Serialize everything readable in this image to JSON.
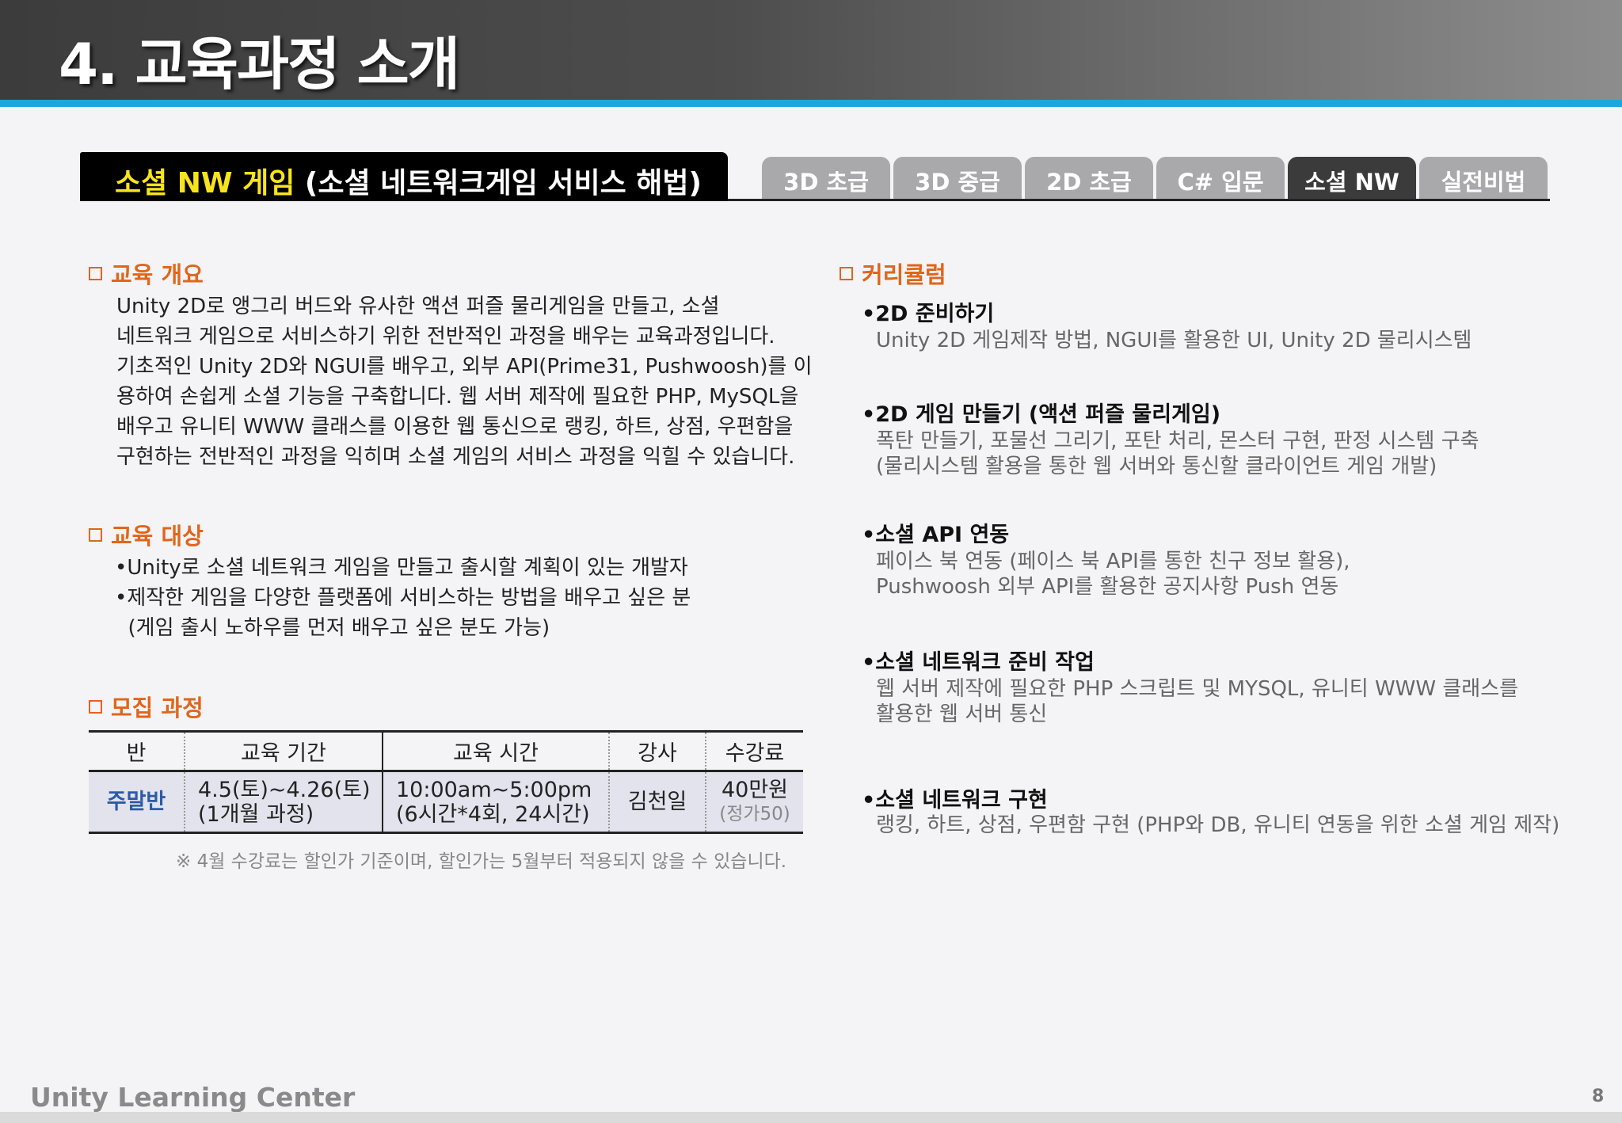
{
  "slide": {
    "title": "4. 교육과정 소개",
    "page_number": "8",
    "footer": "Unity Learning Center"
  },
  "banner": {
    "highlight": "소셜 NW 게임",
    "rest": " (소셜 네트워크게임 서비스 해법)"
  },
  "tabs": [
    {
      "label": "3D 초급",
      "active": false
    },
    {
      "label": "3D 중급",
      "active": false
    },
    {
      "label": "2D 초급",
      "active": false
    },
    {
      "label": "C# 입문",
      "active": false
    },
    {
      "label": "소셜 NW",
      "active": true
    },
    {
      "label": "실전비법",
      "active": false
    }
  ],
  "overview": {
    "heading": "교육 개요",
    "lines": [
      "Unity 2D로 앵그리 버드와 유사한 액션 퍼즐 물리게임을 만들고, 소셜",
      "네트워크 게임으로 서비스하기 위한 전반적인 과정을 배우는 교육과정입니다.",
      "기초적인 Unity 2D와 NGUI를 배우고, 외부 API(Prime31, Pushwoosh)를 이",
      "용하여 손쉽게 소셜 기능을 구축합니다. 웹 서버 제작에 필요한 PHP, MySQL을",
      "배우고 유니티 WWW 클래스를 이용한 웹 통신으로 랭킹, 하트, 상점, 우편함을",
      "구현하는 전반적인 과정을 익히며 소셜 게임의 서비스 과정을 익힐 수 있습니다."
    ]
  },
  "target": {
    "heading": "교육 대상",
    "bullets": [
      "•Unity로 소셜 네트워크 게임을 만들고 출시할 계획이 있는 개발자",
      "•제작한 게임을 다양한 플랫폼에 서비스하는 방법을 배우고 싶은 분",
      "  (게임 출시 노하우를 먼저 배우고 싶은 분도 가능)"
    ]
  },
  "recruit": {
    "heading": "모집 과정",
    "headers": [
      "반",
      "교육 기간",
      "교육 시간",
      "강사",
      "수강료"
    ],
    "row": {
      "class": "주말반",
      "period_line1": "4.5(토)~4.26(토)",
      "period_line2": "(1개월 과정)",
      "time_line1": "10:00am~5:00pm",
      "time_line2": "(6시간*4회, 24시간)",
      "instructor": "김천일",
      "fee": "40만원",
      "fee_regular": "(정가50)"
    },
    "note": "※ 4월 수강료는 할인가 기준이며, 할인가는 5월부터 적용되지 않을 수 있습니다."
  },
  "curriculum": {
    "heading": "커리큘럼",
    "items": [
      {
        "title": "•2D 준비하기",
        "desc": [
          "Unity 2D 게임제작 방법, NGUI를 활용한 UI, Unity 2D 물리시스템"
        ]
      },
      {
        "title": "•2D 게임 만들기 (액션 퍼즐 물리게임)",
        "desc": [
          "폭탄 만들기, 포물선 그리기, 포탄 처리, 몬스터 구현, 판정 시스템 구축",
          "(물리시스템 활용을 통한 웹 서버와 통신할 클라이언트 게임 개발)"
        ]
      },
      {
        "title": "•소셜 API 연동",
        "desc": [
          "페이스 북 연동 (페이스 북 API를 통한 친구 정보 활용),",
          "Pushwoosh 외부 API를 활용한 공지사항 Push 연동"
        ]
      },
      {
        "title": "•소셜 네트워크 준비 작업",
        "desc": [
          "웹 서버 제작에 필요한 PHP 스크립트 및 MYSQL, 유니티 WWW 클래스를",
          "활용한 웹 서버 통신"
        ]
      },
      {
        "title": "•소셜 네트워크 구현",
        "desc": [
          "랭킹, 하트, 상점, 우편함 구현 (PHP와 DB, 유니티 연동을 위한 소셜 게임 제작)"
        ]
      }
    ]
  },
  "colors": {
    "accent_orange": "#e0661c",
    "stripe_blue": "#1da6dd",
    "banner_yellow": "#f7e41d",
    "class_blue": "#2c5aa8"
  }
}
